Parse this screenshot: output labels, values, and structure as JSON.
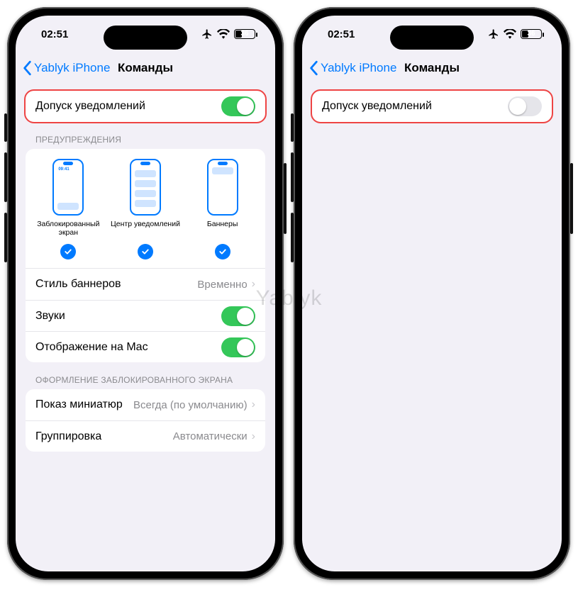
{
  "watermark": "Yablyk",
  "status": {
    "time": "02:51",
    "battery": "36",
    "icons": {
      "airplane": "airplane-icon",
      "wifi": "wifi-icon",
      "battery": "battery-icon"
    }
  },
  "nav": {
    "back_label": "Yablyk iPhone",
    "title": "Команды"
  },
  "sections": {
    "allow": {
      "label": "Допуск уведомлений"
    },
    "alerts_header": "ПРЕДУПРЕЖДЕНИЯ",
    "alerts": {
      "lockscreen": "Заблокированный экран",
      "center": "Центр уведомлений",
      "banners": "Баннеры",
      "lock_time": "09:41"
    },
    "banner_style": {
      "label": "Стиль баннеров",
      "value": "Временно"
    },
    "sounds": {
      "label": "Звуки"
    },
    "show_on_mac": {
      "label": "Отображение на Mac"
    },
    "lockscreen_header": "ОФОРМЛЕНИЕ ЗАБЛОКИРОВАННОГО ЭКРАНА",
    "previews": {
      "label": "Показ миниатюр",
      "value": "Всегда (по умолчанию)"
    },
    "grouping": {
      "label": "Группировка",
      "value": "Автоматически"
    }
  },
  "phones": {
    "left": {
      "allow_on": true
    },
    "right": {
      "allow_on": false
    }
  }
}
